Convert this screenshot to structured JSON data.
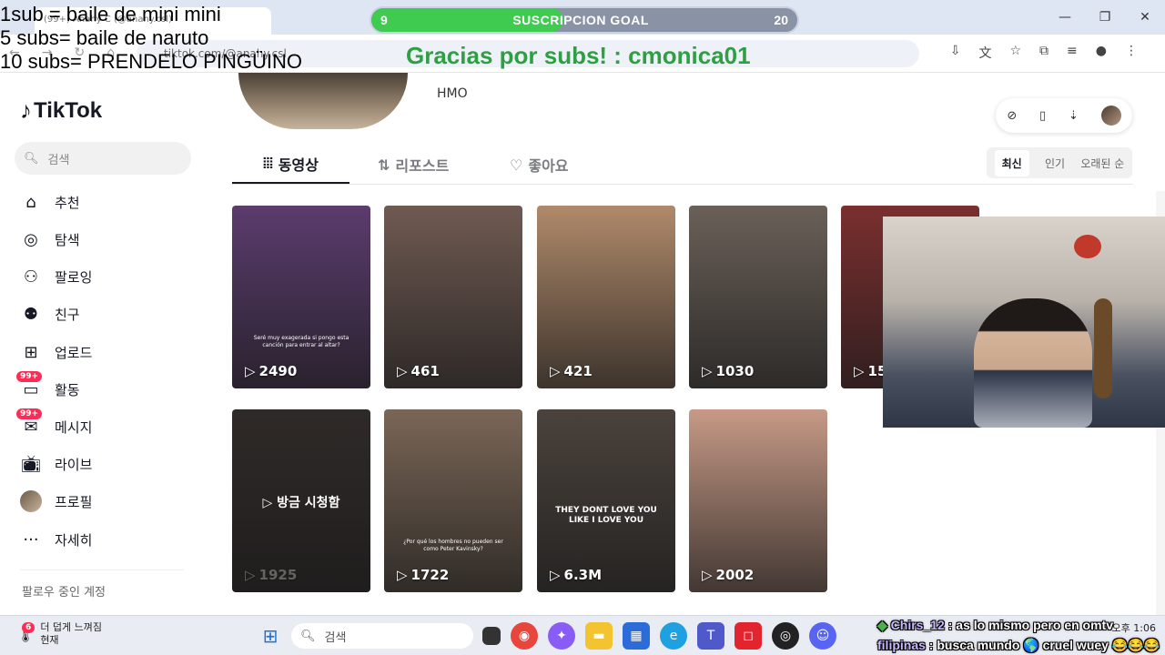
{
  "overlay": {
    "lines": [
      "1sub = baile de mini mini",
      "5 subs= baile de naruto",
      "10 subs= PRENDELO PINGÜINO"
    ],
    "goal": {
      "current": "9",
      "target": "20",
      "label": "SUSCRIPCION GOAL",
      "progress": 0.45
    },
    "thanks": "Gracias por subs! : cmonica01"
  },
  "browser": {
    "tab_title": "(99+) Anahy C (@anahy.csl)",
    "url": "tiktok.com/@anahy.csl",
    "accent": "#dfe6f3"
  },
  "sidebar": {
    "logo": "TikTok",
    "search_placeholder": "검색",
    "items": [
      {
        "label": "추천",
        "icon": "home-icon"
      },
      {
        "label": "탐색",
        "icon": "compass-icon"
      },
      {
        "label": "팔로잉",
        "icon": "following-icon"
      },
      {
        "label": "친구",
        "icon": "friends-icon"
      },
      {
        "label": "업로드",
        "icon": "upload-icon"
      },
      {
        "label": "활동",
        "icon": "activity-icon",
        "badge": "99+"
      },
      {
        "label": "메시지",
        "icon": "message-icon",
        "badge": "99+"
      },
      {
        "label": "라이브",
        "icon": "live-icon"
      },
      {
        "label": "프로필",
        "icon": "profile-avatar"
      },
      {
        "label": "자세히",
        "icon": "more-icon"
      }
    ],
    "following_label": "팔로우 중인 계정"
  },
  "profile": {
    "bio": "HMO"
  },
  "tabs": [
    {
      "label": "동영상",
      "active": true
    },
    {
      "label": "리포스트",
      "active": false
    },
    {
      "label": "좋아요",
      "active": false
    }
  ],
  "sort": [
    "최신",
    "인기",
    "오래된 순"
  ],
  "videos": [
    {
      "views": "2490",
      "caption": "Seré muy exagerada si pongo esta canción para entrar al altar?",
      "color": "#5b3c6e"
    },
    {
      "views": "461",
      "color": "#6f5a52"
    },
    {
      "views": "421",
      "color": "#b08a6a"
    },
    {
      "views": "1030",
      "color": "#6a6058"
    },
    {
      "views": "15",
      "color": "#7b2f2f"
    },
    {
      "views": "1925",
      "center_label": "방금 시청함",
      "color": "#2f2a28"
    },
    {
      "views": "1722",
      "caption": "¿Por qué los hombres no pueden ser como Peter Kavinsky?",
      "color": "#7a6656"
    },
    {
      "views": "6.3M",
      "mid": "THEY DONT LOVE YOU LIKE I LOVE YOU",
      "color": "#4a423c"
    },
    {
      "views": "2002",
      "color": "#c79a86"
    }
  ],
  "taskbar": {
    "weather_badge": "6",
    "weather_line1": "더 덥게 느껴짐",
    "weather_line2": "현재",
    "search_placeholder": "검색",
    "time": "오후 1:06"
  },
  "chat": [
    {
      "user": "Chirs_12",
      "message": "as lo mismo pero en omtv"
    },
    {
      "user": "filipinas",
      "message": "busca mundo 🌎 cruel wuey 😂😂😂"
    }
  ]
}
